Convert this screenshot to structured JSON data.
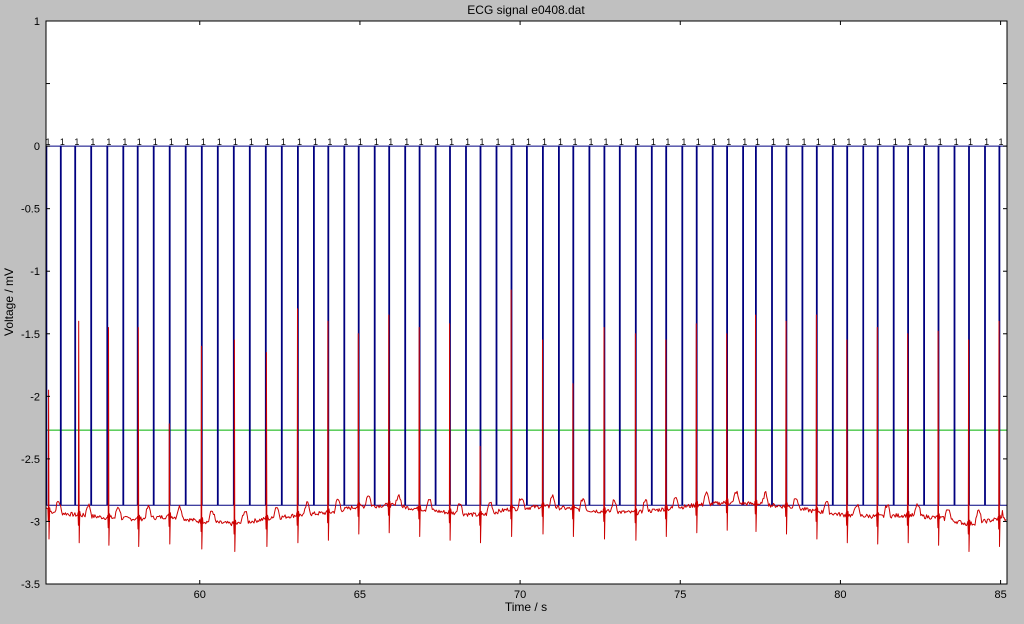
{
  "chart_data": {
    "type": "line",
    "title": "ECG signal e0408.dat",
    "xlabel": "Time / s",
    "ylabel": "Voltage / mV",
    "xlim": [
      55.2,
      85.2
    ],
    "ylim": [
      -3.5,
      1
    ],
    "xticks": [
      60,
      65,
      70,
      75,
      80,
      85
    ],
    "yticks": [
      1,
      0.5,
      0,
      -0.5,
      -1,
      -1.5,
      -2,
      -2.5,
      -3,
      -3.5
    ],
    "ytick_labels": [
      "1",
      "",
      "0",
      "-0.5",
      "-1",
      "-1.5",
      "-2",
      "-2.5",
      "-3",
      "-3.5"
    ],
    "grid": false,
    "background": "#ffffff",
    "series": [
      {
        "role": "ecg",
        "color": "#cc0000",
        "baseline": -2.93,
        "beat_times": [
          55.28,
          56.22,
          57.15,
          58.08,
          59.05,
          60.05,
          61.08,
          62.08,
          63.05,
          64.0,
          64.95,
          65.9,
          66.85,
          67.8,
          68.75,
          69.72,
          70.7,
          71.65,
          72.62,
          73.6,
          74.55,
          75.5,
          76.45,
          77.35,
          78.3,
          79.25,
          80.2,
          81.15,
          82.1,
          83.05,
          84.0,
          84.95
        ],
        "r_peaks": [
          -1.95,
          -1.4,
          -1.45,
          -1.45,
          -2.22,
          -1.6,
          -1.55,
          -1.65,
          -1.3,
          -1.4,
          -1.5,
          -1.35,
          -1.45,
          -1.42,
          -2.4,
          -1.15,
          -1.55,
          -1.9,
          -1.45,
          -1.5,
          -1.55,
          -1.42,
          -1.5,
          -1.35,
          -1.4,
          -1.35,
          -1.55,
          -1.45,
          -1.5,
          -1.48,
          -1.55,
          -1.4
        ],
        "baseline_drift": [
          -2.92,
          -2.95,
          -2.97,
          -2.98,
          -2.96,
          -3.0,
          -3.02,
          -2.98,
          -2.95,
          -2.93,
          -2.88,
          -2.87,
          -2.9,
          -2.93,
          -2.95,
          -2.9,
          -2.88,
          -2.9,
          -2.92,
          -2.93,
          -2.9,
          -2.87,
          -2.85,
          -2.86,
          -2.88,
          -2.92,
          -2.95,
          -2.96,
          -2.95,
          -2.97,
          -3.02,
          -2.98
        ]
      },
      {
        "role": "detected-peaks",
        "color": "#000080",
        "top": 0,
        "level": -2.87,
        "peak_times": [
          55.65,
          56.1,
          57.1,
          58.05,
          59.05,
          60.05,
          61.05,
          62.05,
          63.05,
          64.0,
          64.95,
          65.9,
          66.85,
          67.8,
          68.75,
          69.72,
          70.7,
          71.65,
          72.62,
          73.6,
          74.55,
          75.5,
          76.45,
          77.35,
          78.3,
          79.25,
          80.2,
          81.15,
          82.1,
          83.05,
          84.0,
          84.95,
          55.2,
          56.6,
          57.6,
          58.55,
          59.55,
          60.55,
          61.55,
          62.55,
          63.55,
          64.5,
          65.45,
          66.4,
          67.35,
          68.3,
          69.25,
          70.2,
          71.2,
          72.15,
          73.1,
          74.1,
          75.05,
          76.0,
          76.95,
          77.85,
          78.8,
          79.75,
          80.7,
          81.65,
          82.6,
          83.55,
          84.5
        ]
      },
      {
        "role": "threshold",
        "color": "#00b000",
        "value": -2.27
      }
    ]
  }
}
